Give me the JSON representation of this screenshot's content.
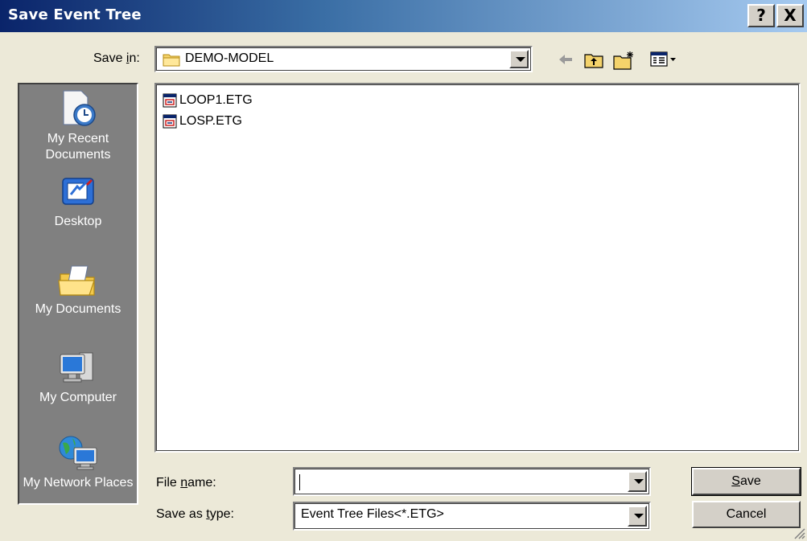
{
  "window": {
    "title": "Save Event Tree",
    "help_label": "?",
    "close_label": "X"
  },
  "save_in": {
    "label_prefix": "Save ",
    "label_accel": "i",
    "label_suffix": "n:",
    "value": "DEMO-MODEL"
  },
  "toolbar": {
    "back_icon": "back-arrow-icon",
    "up_icon": "up-one-level-icon",
    "new_folder_icon": "new-folder-icon",
    "views_icon": "views-menu-icon"
  },
  "places": [
    {
      "label": "My Recent Documents",
      "icon": "recent-documents-icon"
    },
    {
      "label": "Desktop",
      "icon": "desktop-icon"
    },
    {
      "label": "My Documents",
      "icon": "my-documents-icon"
    },
    {
      "label": "My Computer",
      "icon": "my-computer-icon"
    },
    {
      "label": "My Network Places",
      "icon": "network-places-icon"
    }
  ],
  "files": [
    {
      "name": "LOOP1.ETG",
      "icon": "etg-file-icon"
    },
    {
      "name": "LOSP.ETG",
      "icon": "etg-file-icon"
    }
  ],
  "file_name": {
    "label_prefix": "File ",
    "label_accel": "n",
    "label_suffix": "ame:",
    "value": ""
  },
  "save_type": {
    "label_prefix": "Save as ",
    "label_accel": "t",
    "label_suffix": "ype:",
    "value": "Event Tree Files<*.ETG>"
  },
  "buttons": {
    "save_accel": "S",
    "save_rest": "ave",
    "cancel": "Cancel"
  }
}
